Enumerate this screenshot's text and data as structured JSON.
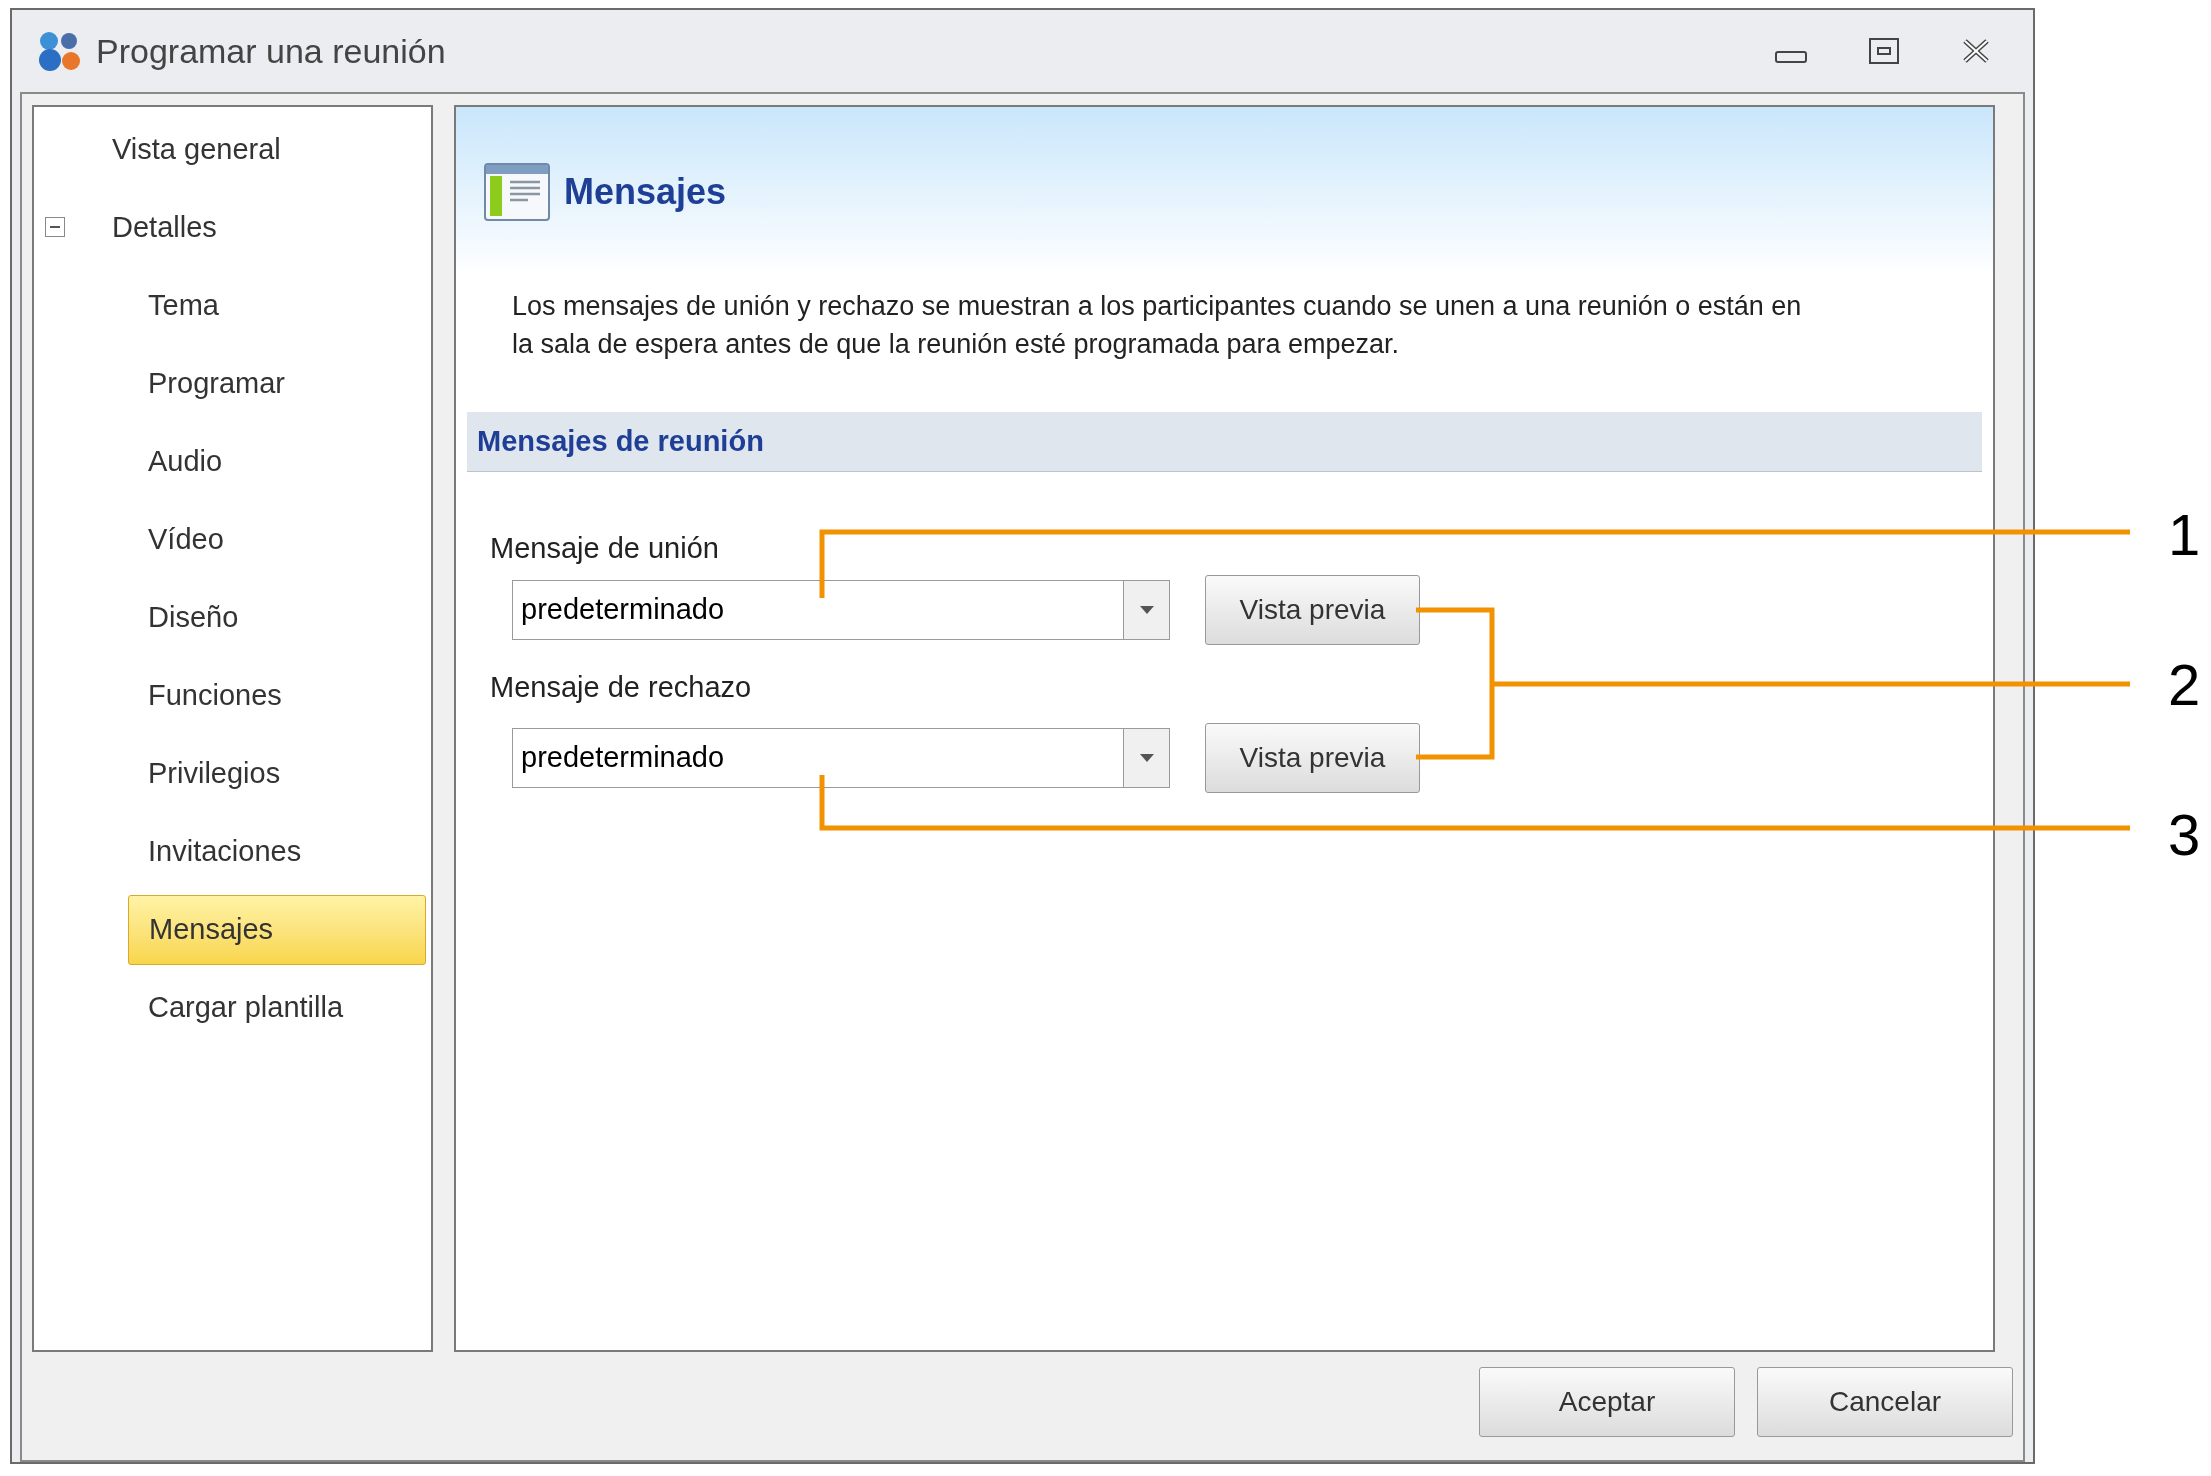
{
  "window": {
    "title": "Programar una reunión"
  },
  "sidebar": {
    "items": [
      {
        "label": "Vista general",
        "selected": false
      },
      {
        "label": "Detalles",
        "selected": false,
        "expanded": true,
        "children": [
          {
            "label": "Tema",
            "selected": false
          },
          {
            "label": "Programar",
            "selected": false
          },
          {
            "label": "Audio",
            "selected": false
          },
          {
            "label": "Vídeo",
            "selected": false
          },
          {
            "label": "Diseño",
            "selected": false
          },
          {
            "label": "Funciones",
            "selected": false
          },
          {
            "label": "Privilegios",
            "selected": false
          },
          {
            "label": "Invitaciones",
            "selected": false
          },
          {
            "label": "Mensajes",
            "selected": true
          },
          {
            "label": "Cargar plantilla",
            "selected": false
          }
        ]
      }
    ]
  },
  "header": {
    "title": "Mensajes"
  },
  "description": "Los mensajes de unión y rechazo se muestran a los participantes cuando se unen a una reunión o están en la sala de espera antes de que la reunión esté programada para empezar.",
  "section": {
    "title": "Mensajes de reunión"
  },
  "fields": [
    {
      "label": "Mensaje de unión",
      "value": "predeterminado",
      "button": "Vista previa"
    },
    {
      "label": "Mensaje de rechazo",
      "value": "predeterminado",
      "button": "Vista previa"
    }
  ],
  "buttons": [
    "Aceptar",
    "Cancelar"
  ],
  "callouts": [
    "1",
    "2",
    "3"
  ]
}
